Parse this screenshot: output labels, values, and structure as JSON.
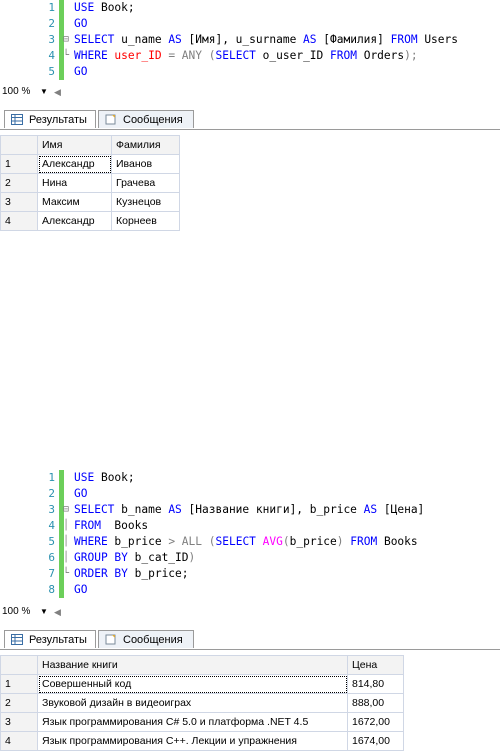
{
  "query1": {
    "lines": [
      {
        "n": "1",
        "tokens": [
          [
            "kw",
            "USE "
          ],
          [
            "",
            "Book;"
          ]
        ]
      },
      {
        "n": "2",
        "tokens": [
          [
            "kw",
            "GO"
          ]
        ]
      },
      {
        "n": "3",
        "tokens": [
          [
            "kw",
            "SELECT "
          ],
          [
            "",
            "u_name "
          ],
          [
            "kw",
            "AS "
          ],
          [
            "",
            "[Имя], u_surname "
          ],
          [
            "kw",
            "AS "
          ],
          [
            "",
            "[Фамилия] "
          ],
          [
            "kw",
            "FROM "
          ],
          [
            "",
            "Users"
          ]
        ]
      },
      {
        "n": "4",
        "tokens": [
          [
            "kw",
            "WHERE "
          ],
          [
            "str",
            "user_ID "
          ],
          [
            "gray",
            "= "
          ],
          [
            "gray",
            "ANY "
          ],
          [
            "gray",
            "("
          ],
          [
            "kw",
            "SELECT "
          ],
          [
            "",
            "o_user_ID "
          ],
          [
            "kw",
            "FROM "
          ],
          [
            "",
            "Orders"
          ],
          [
            "gray",
            ");"
          ]
        ]
      },
      {
        "n": "5",
        "tokens": [
          [
            "kw",
            "GO"
          ]
        ]
      }
    ],
    "zoom": "100 %",
    "tabs": {
      "results": "Результаты",
      "messages": "Сообщения"
    },
    "columns": [
      "Имя",
      "Фамилия"
    ],
    "rows": [
      {
        "n": "1",
        "cells": [
          "Александр",
          "Иванов"
        ]
      },
      {
        "n": "2",
        "cells": [
          "Нина",
          "Грачева"
        ]
      },
      {
        "n": "3",
        "cells": [
          "Максим",
          "Кузнецов"
        ]
      },
      {
        "n": "4",
        "cells": [
          "Александр",
          "Корнеев"
        ]
      }
    ]
  },
  "query2": {
    "lines": [
      {
        "n": "1",
        "tokens": [
          [
            "kw",
            "USE "
          ],
          [
            "",
            "Book;"
          ]
        ]
      },
      {
        "n": "2",
        "tokens": [
          [
            "kw",
            "GO"
          ]
        ]
      },
      {
        "n": "3",
        "tokens": [
          [
            "kw",
            "SELECT "
          ],
          [
            "",
            "b_name "
          ],
          [
            "kw",
            "AS "
          ],
          [
            "",
            "[Название книги], b_price "
          ],
          [
            "kw",
            "AS "
          ],
          [
            "",
            "[Цена]"
          ]
        ]
      },
      {
        "n": "4",
        "tokens": [
          [
            "kw",
            "FROM  "
          ],
          [
            "",
            "Books"
          ]
        ]
      },
      {
        "n": "5",
        "tokens": [
          [
            "kw",
            "WHERE "
          ],
          [
            "",
            "b_price "
          ],
          [
            "gray",
            "> "
          ],
          [
            "gray",
            "ALL "
          ],
          [
            "gray",
            "("
          ],
          [
            "kw",
            "SELECT "
          ],
          [
            "fn",
            "AVG"
          ],
          [
            "gray",
            "("
          ],
          [
            "",
            "b_price"
          ],
          [
            "gray",
            ") "
          ],
          [
            "kw",
            "FROM "
          ],
          [
            "",
            "Books"
          ]
        ]
      },
      {
        "n": "6",
        "tokens": [
          [
            "kw",
            "GROUP BY "
          ],
          [
            "",
            "b_cat_ID"
          ],
          [
            "gray",
            ")"
          ]
        ]
      },
      {
        "n": "7",
        "tokens": [
          [
            "kw",
            "ORDER BY "
          ],
          [
            "",
            "b_price;"
          ]
        ]
      },
      {
        "n": "8",
        "tokens": [
          [
            "kw",
            "GO"
          ]
        ]
      }
    ],
    "zoom": "100 %",
    "tabs": {
      "results": "Результаты",
      "messages": "Сообщения"
    },
    "columns": [
      "Название книги",
      "Цена"
    ],
    "rows": [
      {
        "n": "1",
        "cells": [
          "Совершенный код",
          "814,80"
        ]
      },
      {
        "n": "2",
        "cells": [
          "Звуковой дизайн в видеоиграх",
          "888,00"
        ]
      },
      {
        "n": "3",
        "cells": [
          "Язык программирования C# 5.0 и платформа .NET 4.5",
          "1672,00"
        ]
      },
      {
        "n": "4",
        "cells": [
          "Язык программирования C++. Лекции и упражнения",
          "1674,00"
        ]
      }
    ]
  }
}
